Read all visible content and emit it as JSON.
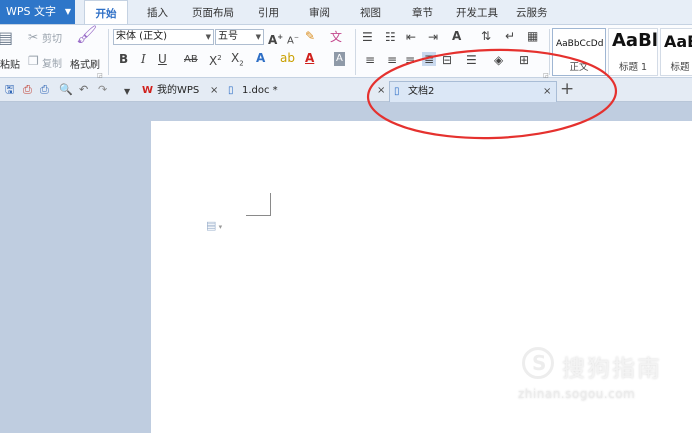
{
  "app": {
    "name": "WPS 文字"
  },
  "menu_tabs": [
    "开始",
    "插入",
    "页面布局",
    "引用",
    "审阅",
    "视图",
    "章节",
    "开发工具",
    "云服务"
  ],
  "ribbon": {
    "paste": "粘贴",
    "cut": "剪切",
    "copy": "复制",
    "format_painter": "格式刷",
    "font_name": "宋体 (正文)",
    "font_size": "五号",
    "styles": [
      {
        "sample": "AaBbCcDd",
        "caption": "正文"
      },
      {
        "sample": "AaBl",
        "caption": "标题 1"
      },
      {
        "sample": "AaB",
        "caption": "标题"
      }
    ]
  },
  "doc_tabs": [
    {
      "label": "我的WPS"
    },
    {
      "label": "1.doc *"
    },
    {
      "label": "文档2"
    }
  ],
  "watermark": {
    "title": "搜狗指南",
    "url": "zhinan.sogou.com"
  },
  "colors": {
    "app_button": "#2e76c9",
    "annotation": "#e5312e",
    "active_tab_text": "#2e6fc6"
  }
}
